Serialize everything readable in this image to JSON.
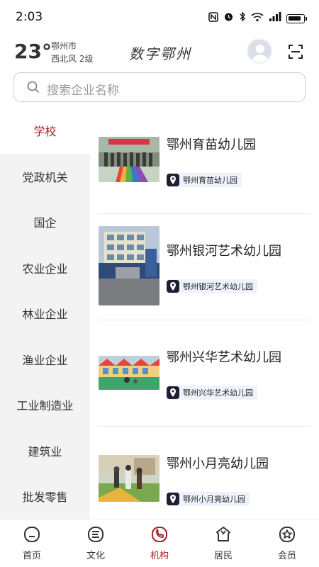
{
  "status_bar": {
    "time": "2:03",
    "icons": [
      "nfc-icon",
      "alarm-icon",
      "bluetooth-icon",
      "wifi-icon",
      "signal-icon",
      "battery-icon"
    ]
  },
  "header": {
    "temperature": "23°",
    "city": "鄂州市",
    "wind": "西北风  2级",
    "logo_text": "数字鄂州"
  },
  "search": {
    "placeholder": "搜索企业名称"
  },
  "sidebar": {
    "items": [
      {
        "label": "学校",
        "active": true
      },
      {
        "label": "党政机关"
      },
      {
        "label": "国企"
      },
      {
        "label": "农业企业"
      },
      {
        "label": "林业企业"
      },
      {
        "label": "渔业企业"
      },
      {
        "label": "工业制造业"
      },
      {
        "label": "建筑业"
      },
      {
        "label": "批发零售"
      }
    ]
  },
  "list": {
    "items": [
      {
        "title": "鄂州育苗幼儿园",
        "tag": "鄂州育苗幼儿园"
      },
      {
        "title": "鄂州银河艺术幼儿园",
        "tag": "鄂州银河艺术幼儿园"
      },
      {
        "title": "鄂州兴华艺术幼儿园",
        "tag": "鄂州兴华艺术幼儿园"
      },
      {
        "title": "鄂州小月亮幼儿园",
        "tag": "鄂州小月亮幼儿园"
      }
    ]
  },
  "tabbar": {
    "items": [
      {
        "label": "首页",
        "icon": "home-icon"
      },
      {
        "label": "文化",
        "icon": "culture-icon"
      },
      {
        "label": "机构",
        "icon": "institution-icon",
        "active": true
      },
      {
        "label": "居民",
        "icon": "resident-icon"
      },
      {
        "label": "会员",
        "icon": "member-icon"
      }
    ]
  },
  "colors": {
    "accent": "#a3222a",
    "sidebar_bg": "#f3f3f3",
    "tag_bg": "#eef2fb"
  }
}
